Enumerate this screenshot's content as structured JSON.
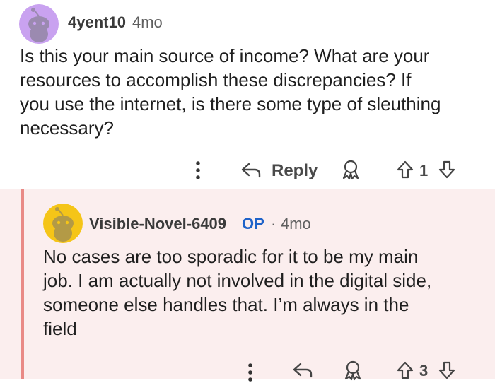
{
  "comment": {
    "username": "4yent10",
    "time": "4mo",
    "body_lines": [
      "Is this your main source of income? What are your",
      "resources to accomplish these discrepancies? If",
      "you use the internet, is there some type of sleuthing",
      "necessary?"
    ],
    "actions": {
      "reply_label": "Reply",
      "vote_count": "1"
    },
    "avatar_color": "#c9a2f0"
  },
  "reply": {
    "username": "Visible-Novel-6409",
    "op_tag": "OP",
    "separator": "·",
    "time": "4mo",
    "body_lines": [
      "No cases are too sporadic for it to be my main",
      "job. I am actually not involved in the digital side,",
      "someone else handles that. I’m always in the",
      "field"
    ],
    "actions": {
      "vote_count": "3"
    },
    "avatar_color": "#f5c518",
    "background": "#fbeeee",
    "thread_line_color": "#e98a86"
  },
  "icons": [
    "more-vertical-icon",
    "reply-arrow-icon",
    "award-icon",
    "upvote-icon",
    "downvote-icon",
    "snoo-avatar-icon"
  ]
}
